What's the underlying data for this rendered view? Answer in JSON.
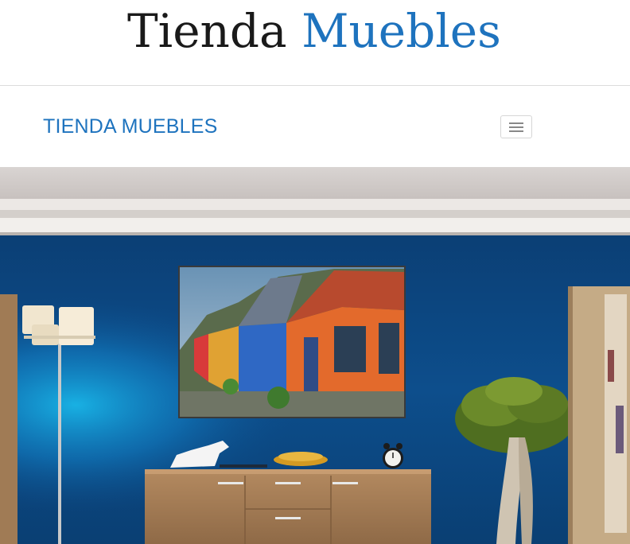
{
  "header": {
    "title_part1": "Tienda ",
    "title_part2": "Muebles"
  },
  "navbar": {
    "brand": "TIENDA MUEBLES",
    "toggle_icon": "hamburger-menu-icon"
  },
  "colors": {
    "accent": "#1e73be",
    "wall": "#0b4a86",
    "text_dark": "#1a1a1a"
  }
}
